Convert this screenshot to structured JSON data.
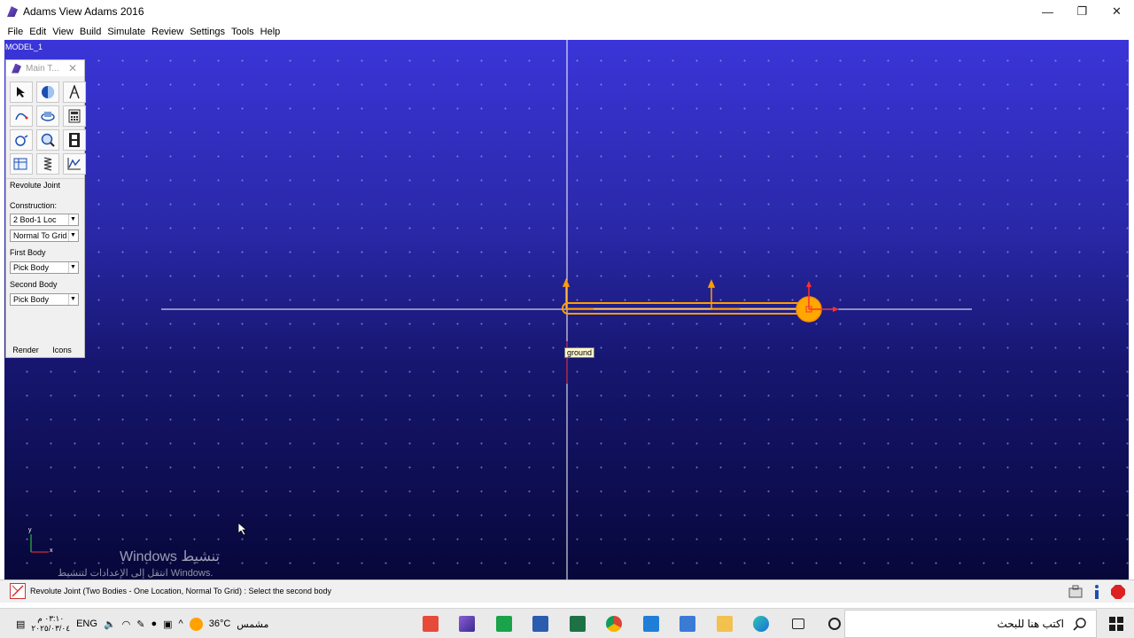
{
  "window": {
    "title": "Adams View Adams 2016",
    "controls": {
      "minimize": "—",
      "maximize": "❐",
      "close": "✕"
    }
  },
  "menu": [
    "File",
    "Edit",
    "View",
    "Build",
    "Simulate",
    "Review",
    "Settings",
    "Tools",
    "Help"
  ],
  "viewport": {
    "model_name": "MODEL_1",
    "ground_label": "ground",
    "triad_y": "y",
    "triad_x": "x",
    "watermark_title": "Windows تنشيط",
    "watermark_sub": "انتقل إلى الإعدادات لتنشيط Windows."
  },
  "toolbox": {
    "title": "Main T...",
    "close": "✕",
    "tools": [
      "select-arrow-icon",
      "sphere-icon",
      "compass-icon",
      "spline-icon",
      "rotate-part-icon",
      "calculator-icon",
      "joint-icon",
      "magnifier-icon",
      "film-icon",
      "table-icon",
      "spring-icon",
      "plot-icon"
    ],
    "mode": "Revolute Joint",
    "construction_label": "Construction:",
    "construction_value": "2 Bod-1 Loc",
    "orientation_value": "Normal To Grid",
    "first_body_label": "First Body",
    "first_body_value": "Pick Body",
    "second_body_label": "Second Body",
    "second_body_value": "Pick Body",
    "render_button": "Render",
    "icons_button": "Icons"
  },
  "status": {
    "message": "Revolute Joint (Two Bodies - One Location, Normal To Grid) : Select the second body"
  },
  "taskbar": {
    "keyboard": "ENG",
    "time": "٠٣:١٠ م",
    "date": "٢٠٢٥/٠٣/٠٤",
    "temperature": "36°C",
    "weather": "مشمس",
    "search_placeholder": "اكتب هنا للبحث"
  },
  "colors": {
    "part": "#ff9d00",
    "marker": "#ff3030",
    "viewport_top": "#3a35d8",
    "viewport_bottom": "#07073a"
  }
}
